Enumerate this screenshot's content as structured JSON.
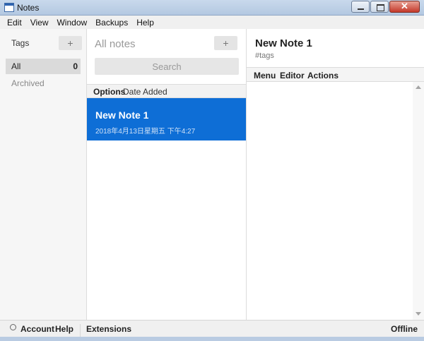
{
  "window": {
    "title": "Notes",
    "controls": {
      "minimize": "minimize",
      "maximize": "maximize",
      "close": "✕"
    }
  },
  "menu": [
    "Edit",
    "View",
    "Window",
    "Backups",
    "Help"
  ],
  "tags_panel": {
    "heading": "Tags",
    "add_label": "+",
    "items": [
      {
        "label": "All",
        "count": "0",
        "selected": true
      },
      {
        "label": "Archived",
        "count": ""
      }
    ]
  },
  "notes_panel": {
    "title": "All notes",
    "add_label": "+",
    "search_placeholder": "Search",
    "options_label": "Options",
    "sort_label": "Date Added",
    "notes": [
      {
        "title": "New Note 1",
        "date": "2018年4月13日星期五 下午4:27",
        "selected": true
      }
    ]
  },
  "editor": {
    "title": "New Note 1",
    "tags_placeholder": "#tags",
    "toolbar": [
      "Menu",
      "Editor",
      "Actions"
    ]
  },
  "footer": {
    "account": "Account",
    "help": "Help",
    "extensions": "Extensions",
    "status": "Offline"
  },
  "colors": {
    "selected_note_bg": "#0e6ed6",
    "sidebar_bg": "#f6f6f6"
  }
}
